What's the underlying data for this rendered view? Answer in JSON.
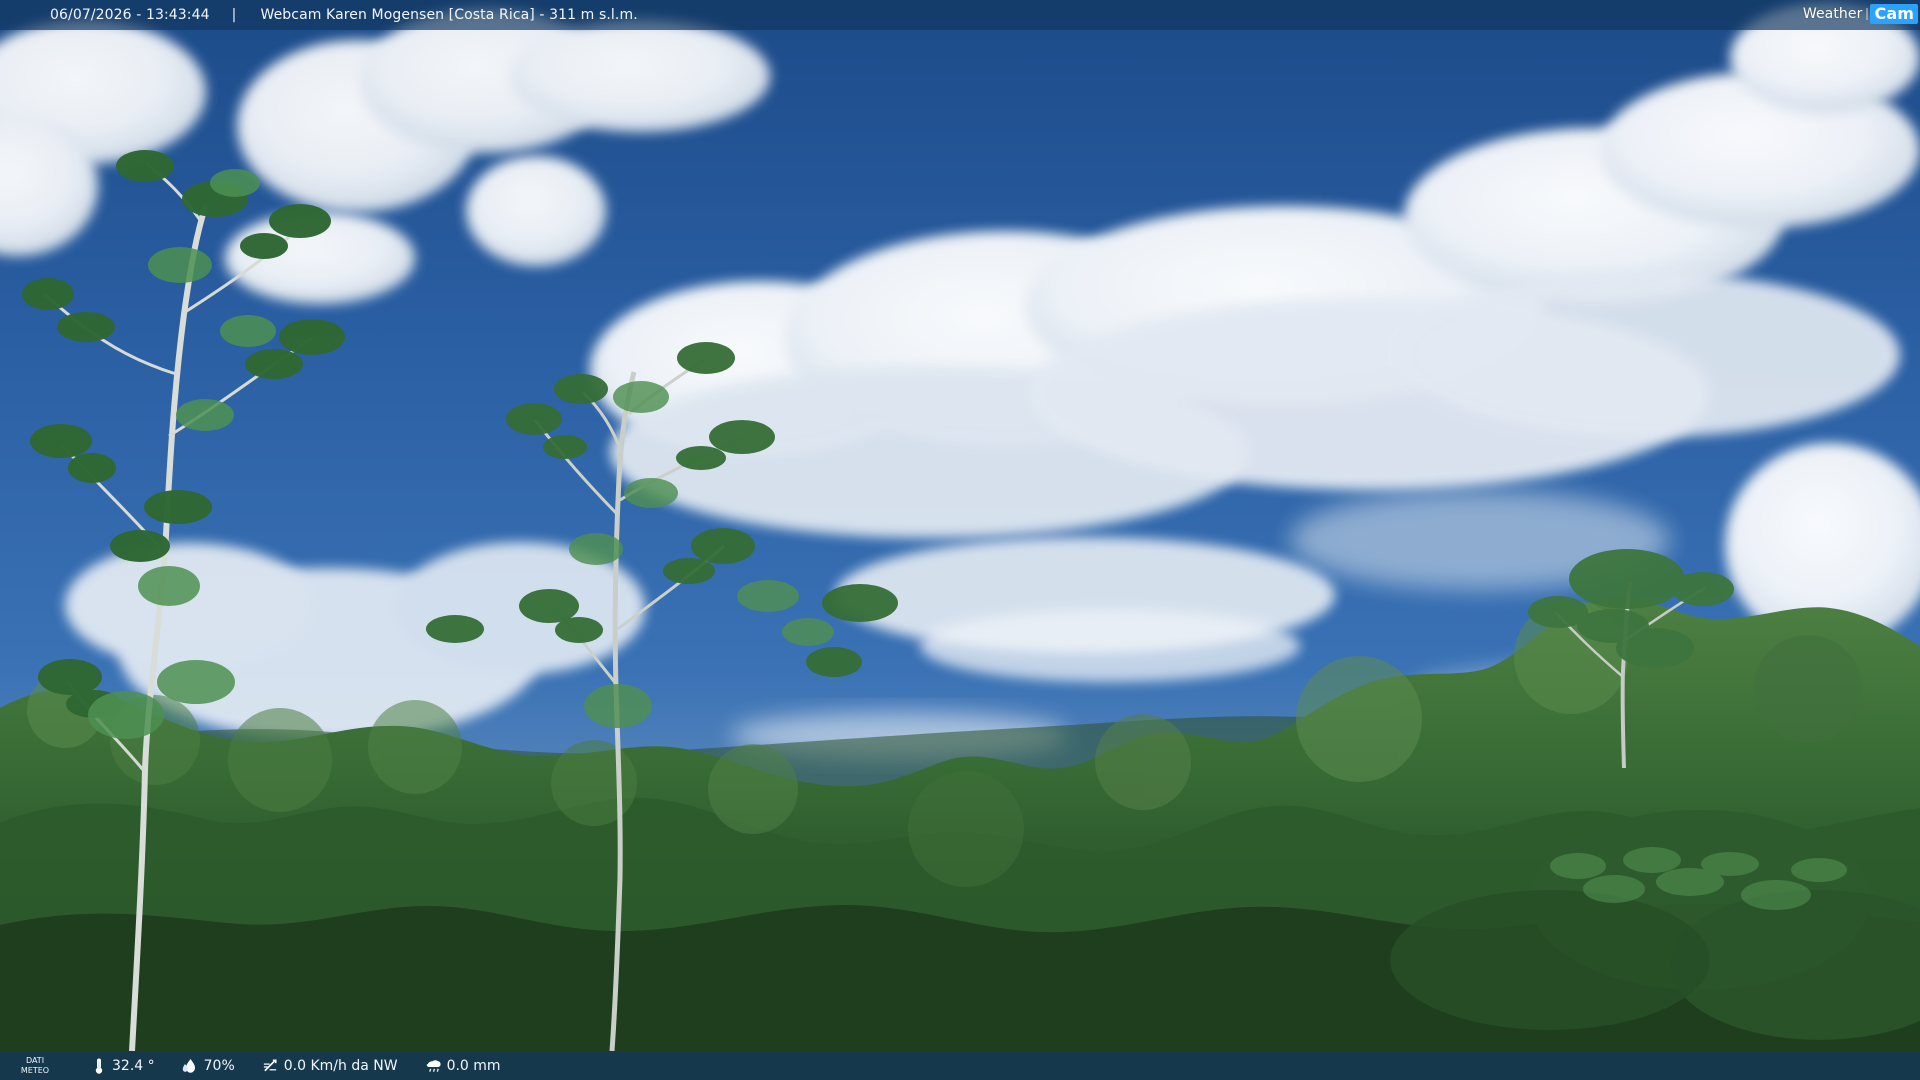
{
  "window": {
    "title": "Webcam Karen Mogensen [Costa Rica]  - 311 m s.l.m."
  },
  "topbar": {
    "datetime": "06/07/2026 - 13:43:44",
    "separator": "|",
    "title": "Webcam Karen Mogensen [Costa Rica]  - 311 m s.l.m."
  },
  "logo": {
    "weather": "Weather",
    "cam": "Cam",
    "icon": "weather-cam-logo-icon"
  },
  "bottombar": {
    "label": "DATI\nMETEO",
    "temperature": "32.4 °",
    "humidity": "70%",
    "wind": "0.0 Km/h da NW",
    "rain": "0.0 mm",
    "icons": {
      "temperature": "thermometer-icon",
      "humidity": "humidity-icon",
      "wind": "wind-icon",
      "rain": "rain-gauge-icon"
    }
  },
  "scene": {
    "sky_colors": [
      "#1f4f8f",
      "#2c62a7",
      "#3f76b8",
      "#8aa9c7"
    ],
    "forest_colors": [
      "#1f3d20",
      "#2d5a2d",
      "#3e743b",
      "#5c8c55"
    ],
    "cloud_colors": [
      "#ffffff",
      "#e9eef5",
      "#d3dde8"
    ]
  }
}
